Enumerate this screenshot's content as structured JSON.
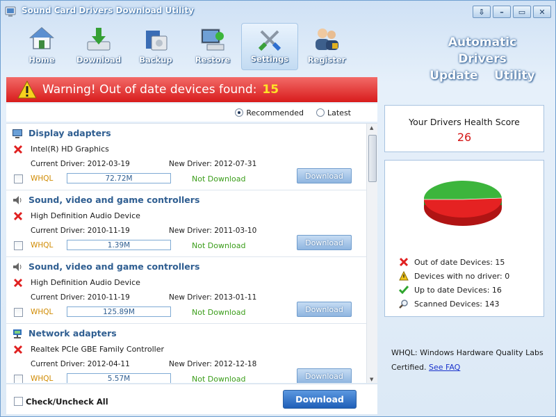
{
  "window": {
    "title": "Sound Card Drivers Download Utility",
    "buttons": [
      "⇩",
      "–",
      "▭",
      "✕"
    ]
  },
  "toolbar": {
    "items": [
      {
        "label": "Home"
      },
      {
        "label": "Download"
      },
      {
        "label": "Backup"
      },
      {
        "label": "Restore"
      },
      {
        "label": "Settings",
        "active": true
      },
      {
        "label": "Register"
      }
    ]
  },
  "brand": {
    "line1": "Automatic Drivers",
    "line2": "Update    Utility"
  },
  "warning": {
    "text": "Warning! Out of date devices found:",
    "count": "15"
  },
  "options": {
    "recommended": "Recommended",
    "latest": "Latest",
    "selected": "Recommended"
  },
  "devices": [
    {
      "category": "Display adapters",
      "icon": "monitor-icon",
      "device": "Intel(R) HD Graphics",
      "current": "Current Driver: 2012-03-19",
      "new": "New Driver: 2012-07-31",
      "whql": "WHQL",
      "size": "72.72M",
      "status": "Not Download",
      "button": "Download"
    },
    {
      "category": "Sound, video and game controllers",
      "icon": "speaker-icon",
      "device": "High Definition Audio Device",
      "current": "Current Driver: 2010-11-19",
      "new": "New Driver: 2011-03-10",
      "whql": "WHQL",
      "size": "1.39M",
      "status": "Not Download",
      "button": "Download"
    },
    {
      "category": "Sound, video and game controllers",
      "icon": "speaker-icon",
      "device": "High Definition Audio Device",
      "current": "Current Driver: 2010-11-19",
      "new": "New Driver: 2013-01-11",
      "whql": "WHQL",
      "size": "125.89M",
      "status": "Not Download",
      "button": "Download"
    },
    {
      "category": "Network adapters",
      "icon": "network-icon",
      "device": "Realtek PCIe GBE Family Controller",
      "current": "Current Driver: 2012-04-11",
      "new": "New Driver: 2012-12-18",
      "whql": "WHQL",
      "size": "5.57M",
      "status": "Not Download",
      "button": "Download"
    }
  ],
  "bottom": {
    "check_all": "Check/Uncheck All",
    "download_all": "Download"
  },
  "health": {
    "title": "Your Drivers Health Score",
    "score": "26"
  },
  "stats": {
    "pie_colors": {
      "up_to_date": "#3cb53c",
      "out_of_date": "#e52222"
    },
    "items": [
      {
        "label": "Out of date Devices: 15",
        "icon": "red-x-icon"
      },
      {
        "label": "Devices with no driver: 0",
        "icon": "warning-icon"
      },
      {
        "label": "Up to date Devices: 16",
        "icon": "green-check-icon"
      },
      {
        "label": "Scanned Devices: 143",
        "icon": "magnifier-icon"
      }
    ]
  },
  "note": {
    "text": "WHQL: Windows Hardware Quality Labs Certified.",
    "link": "See FAQ"
  }
}
